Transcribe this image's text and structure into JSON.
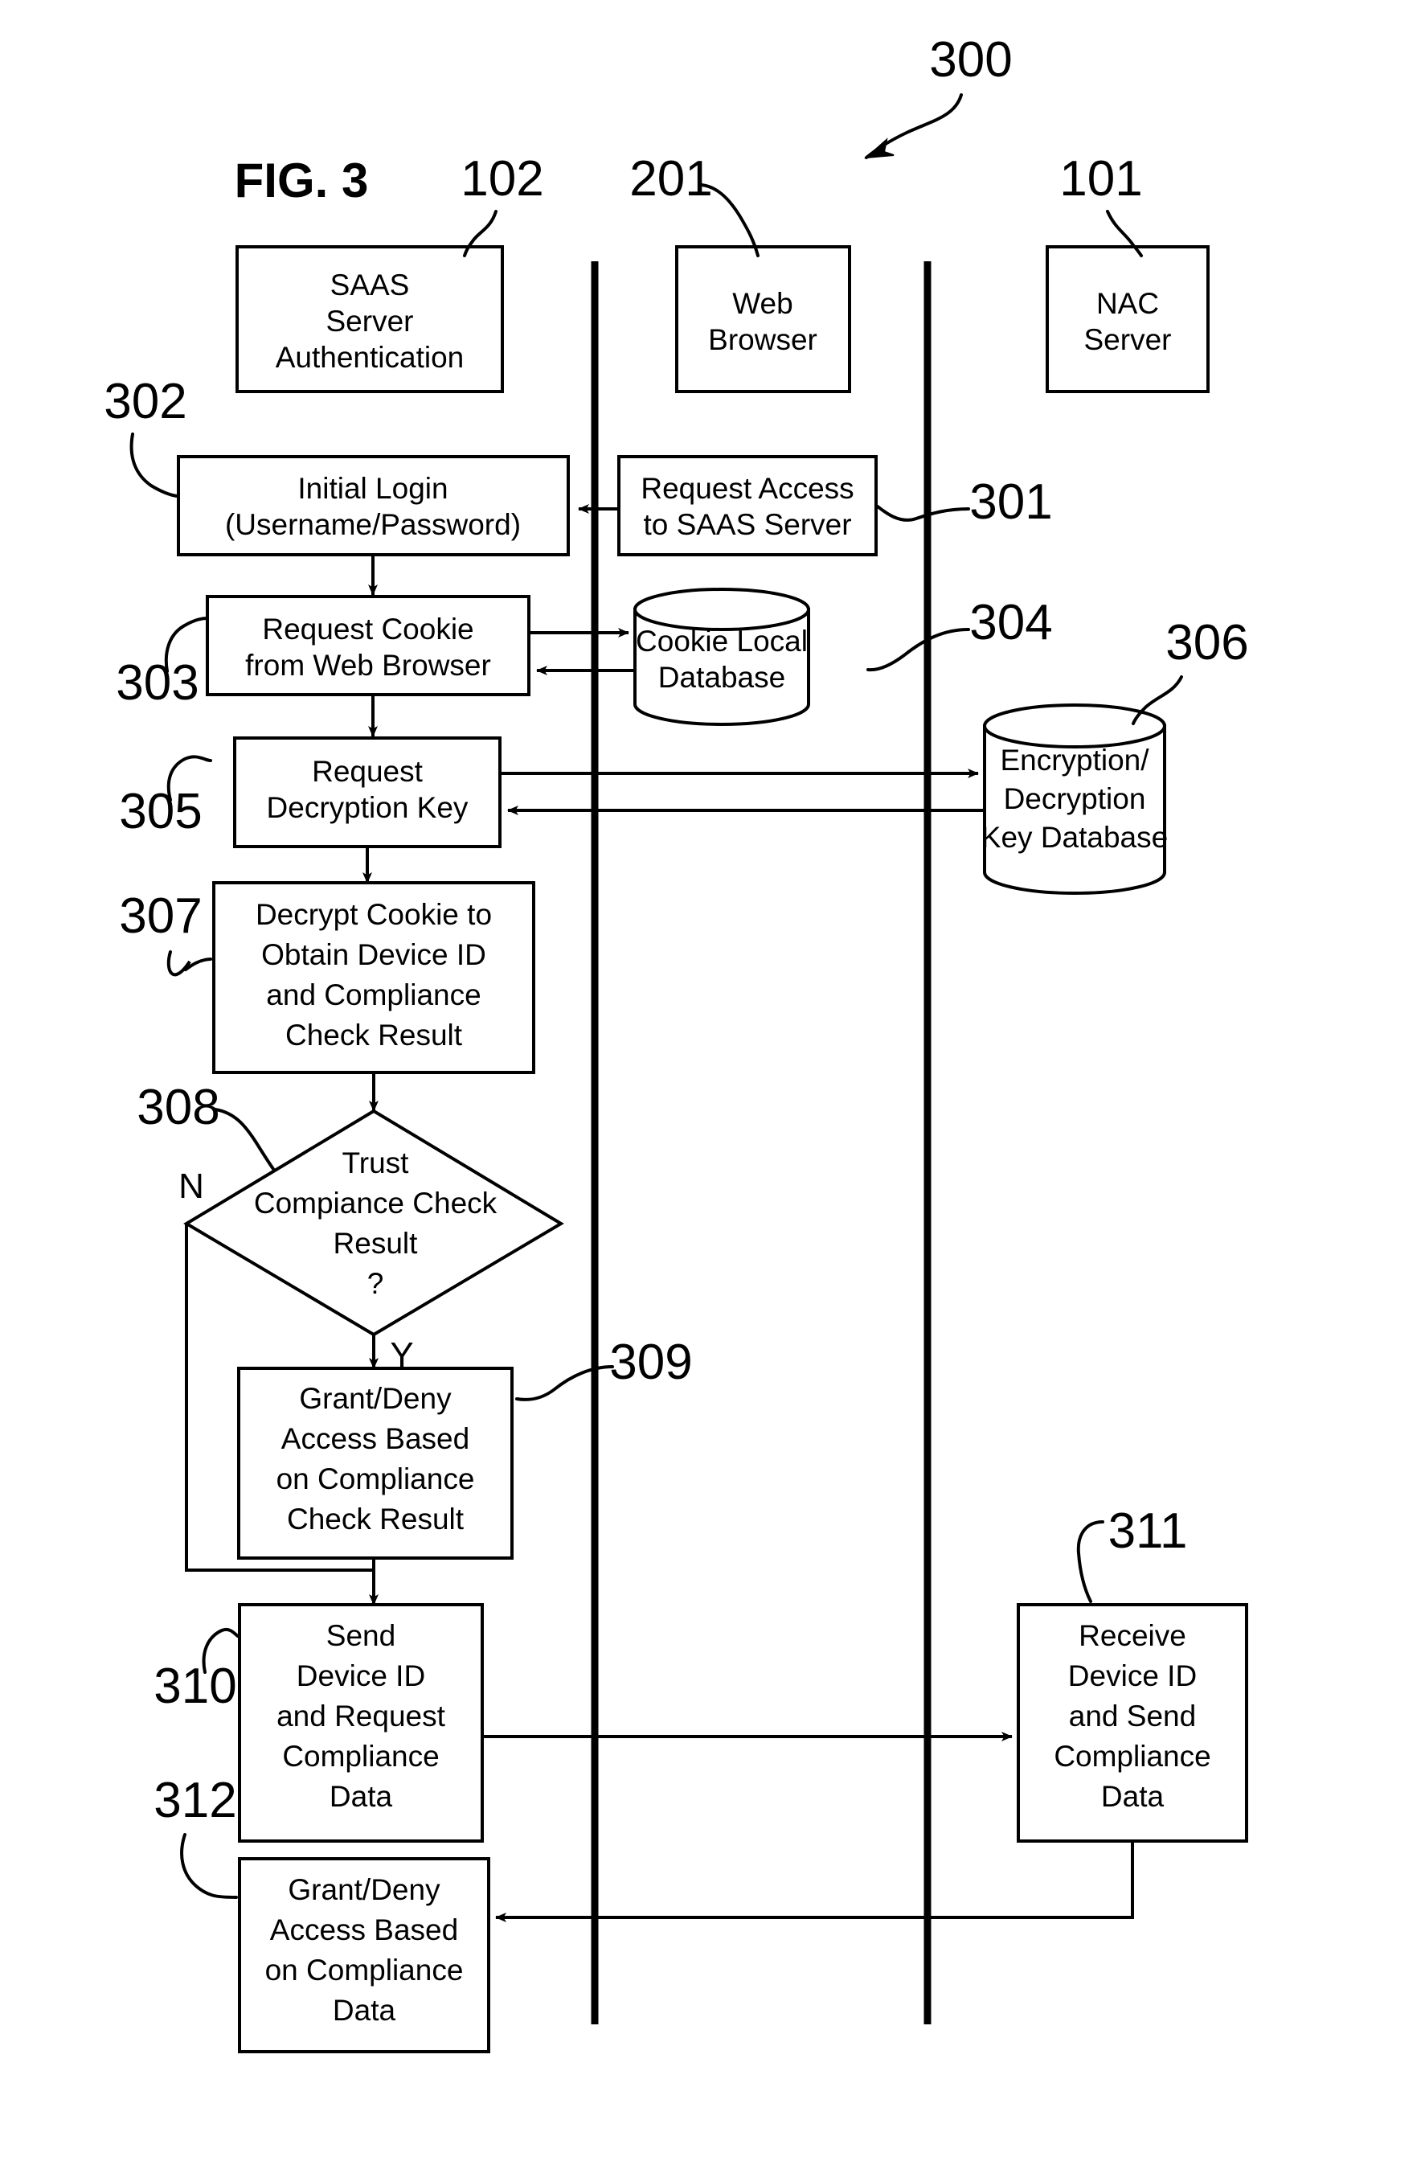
{
  "figure": {
    "label": "FIG. 3",
    "overall_ref": "300"
  },
  "lanes": [
    {
      "name": "saas-server-lane"
    },
    {
      "name": "web-browser-lane"
    },
    {
      "name": "nac-server-lane"
    }
  ],
  "actors": [
    {
      "ref": "102",
      "lines": [
        "SAAS",
        "Server",
        "Authentication"
      ]
    },
    {
      "ref": "201",
      "lines": [
        "Web",
        "Browser"
      ]
    },
    {
      "ref": "101",
      "lines": [
        "NAC",
        "Server"
      ]
    }
  ],
  "nodes": {
    "n301": {
      "ref": "301",
      "shape": "rect",
      "lines": [
        "Request Access",
        "to SAAS Server"
      ]
    },
    "n302": {
      "ref": "302",
      "shape": "rect",
      "lines": [
        "Initial Login",
        "(Username/Password)"
      ]
    },
    "n303": {
      "ref": "303",
      "shape": "rect",
      "lines": [
        "Request Cookie",
        "from Web Browser"
      ]
    },
    "n304": {
      "ref": "304",
      "shape": "cylinder",
      "lines": [
        "Cookie Local",
        "Database"
      ]
    },
    "n305": {
      "ref": "305",
      "shape": "rect",
      "lines": [
        "Request",
        "Decryption Key"
      ]
    },
    "n306": {
      "ref": "306",
      "shape": "cylinder",
      "lines": [
        "Encryption/",
        "Decryption",
        "Key Database"
      ]
    },
    "n307": {
      "ref": "307",
      "shape": "rect",
      "lines": [
        "Decrypt Cookie to",
        "Obtain Device ID",
        "and Compliance",
        "Check Result"
      ]
    },
    "n308": {
      "ref": "308",
      "shape": "diamond",
      "lines": [
        "Trust",
        "Compiance Check",
        "Result",
        "?"
      ]
    },
    "n309": {
      "ref": "309",
      "shape": "rect",
      "lines": [
        "Grant/Deny",
        "Access Based",
        "on Compliance",
        "Check Result"
      ]
    },
    "n310": {
      "ref": "310",
      "shape": "rect",
      "lines": [
        "Send",
        "Device ID",
        "and Request",
        "Compliance",
        "Data"
      ]
    },
    "n311": {
      "ref": "311",
      "shape": "rect",
      "lines": [
        "Receive",
        "Device ID",
        "and Send",
        "Compliance",
        "Data"
      ]
    },
    "n312": {
      "ref": "312",
      "shape": "rect",
      "lines": [
        "Grant/Deny",
        "Access Based",
        "on Compliance",
        "Data"
      ]
    }
  },
  "branches": {
    "no": "N",
    "yes": "Y"
  },
  "colors": {
    "ink": "#000000",
    "paper": "#ffffff"
  }
}
